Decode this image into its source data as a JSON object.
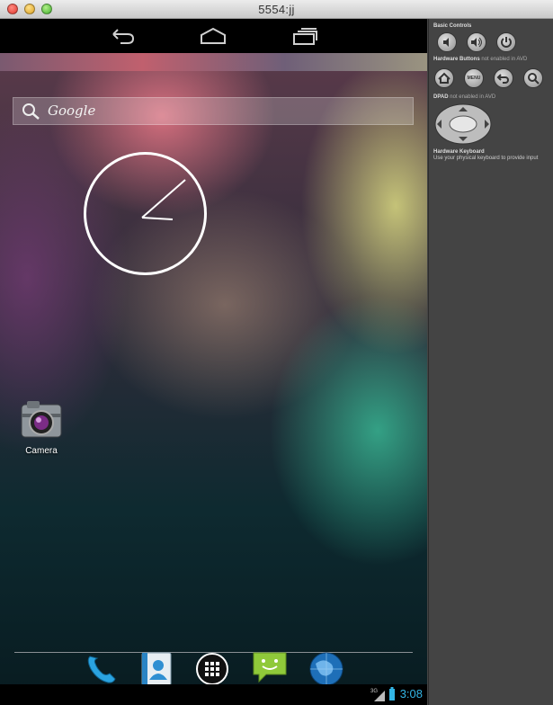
{
  "window": {
    "title": "5554:jj"
  },
  "navbar": {
    "back_icon": "back-icon",
    "home_icon": "home-icon",
    "recents_icon": "recent-apps-icon"
  },
  "search": {
    "label": "Google"
  },
  "home": {
    "camera_label": "Camera"
  },
  "dock": {
    "items": [
      "phone-icon",
      "contacts-icon",
      "all-apps-icon",
      "messaging-icon",
      "browser-icon"
    ]
  },
  "status": {
    "signal": "3G",
    "time": "3:08"
  },
  "panel": {
    "basic_controls": "Basic Controls",
    "hardware_buttons": "Hardware Buttons",
    "hardware_note": "not enabled in AVD",
    "menu_label": "MENU",
    "dpad": "DPAD",
    "dpad_note": "not enabled in AVD",
    "keyboard_title": "Hardware Keyboard",
    "keyboard_note": "Use your physical keyboard to provide input"
  },
  "colors": {
    "accent": "#33b5e5",
    "panel_bg": "#444444"
  }
}
